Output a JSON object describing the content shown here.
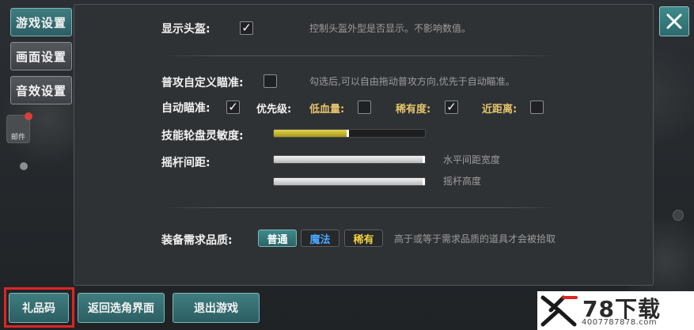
{
  "side_tabs": [
    {
      "label": "游戏设置",
      "active": true
    },
    {
      "label": "画面设置",
      "active": false
    },
    {
      "label": "音效设置",
      "active": false
    }
  ],
  "settings": {
    "show_helmet": {
      "label": "显示头盔:",
      "checked": true,
      "hint": "控制头盔外型是否显示。不影响数值。"
    },
    "custom_aim": {
      "label": "普攻自定义瞄准:",
      "checked": false,
      "hint": "勾选后,可以自由拖动普攻方向,优先于自动瞄准。"
    },
    "auto_aim": {
      "label": "自动瞄准:",
      "checked": true
    },
    "priority": {
      "label": "优先级:",
      "low_hp": {
        "label": "低血量:",
        "checked": false
      },
      "rarity": {
        "label": "稀有度:",
        "checked": true
      },
      "nearest": {
        "label": "近距离:",
        "checked": false
      }
    },
    "skill_wheel_sensitivity": {
      "label": "技能轮盘灵敏度:",
      "value": 0.49
    },
    "joystick_spacing": {
      "label": "摇杆间距:",
      "horizontal": {
        "hint": "水平间距宽度",
        "value": 1.0
      },
      "height": {
        "hint": "摇杆高度",
        "value": 1.0
      }
    },
    "equipment_quality": {
      "label": "装备需求品质:",
      "options": [
        {
          "label": "普通",
          "color": "#ffffff",
          "selected": true
        },
        {
          "label": "魔法",
          "color": "#4aa8ff",
          "selected": false
        },
        {
          "label": "稀有",
          "color": "#f0d040",
          "selected": false
        }
      ],
      "hint": "高于或等于需求品质的道具才会被拾取"
    }
  },
  "bottom_buttons": {
    "gift_code": "礼品码",
    "back_to_character": "返回选角界面",
    "exit_game": "退出游戏"
  },
  "background_avatar_label": "邮件",
  "watermark": {
    "logo": "78下载",
    "url": "4007787878.com"
  },
  "colors": {
    "accent_teal": "#2c5e62",
    "gold": "#e6c46b",
    "highlight_red": "#e02424"
  }
}
